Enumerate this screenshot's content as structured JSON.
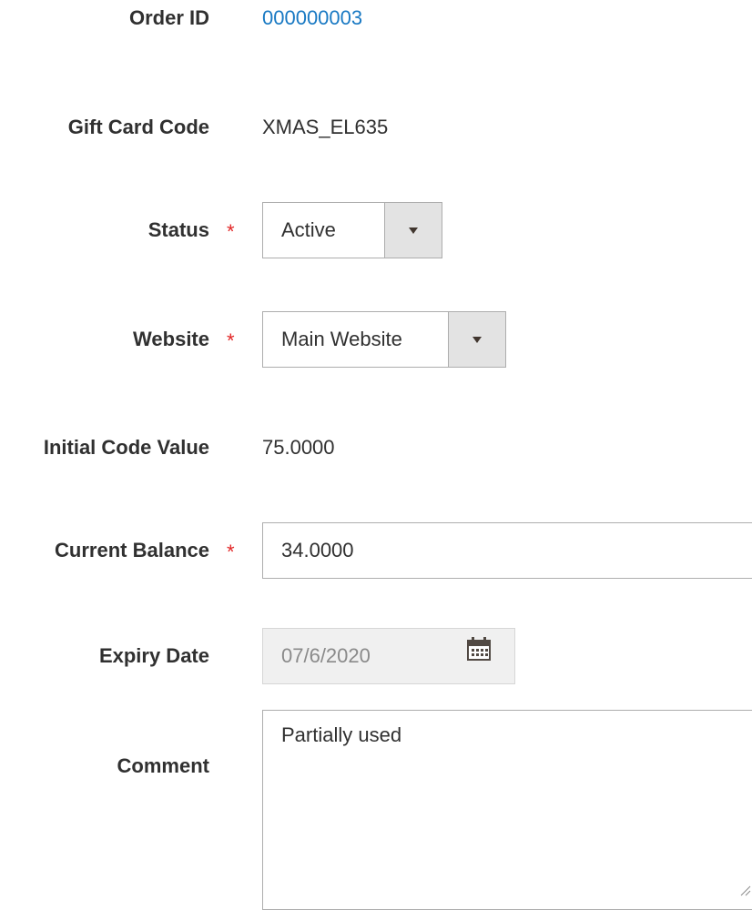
{
  "form": {
    "order_id": {
      "label": "Order ID",
      "value": "000000003"
    },
    "gift_card_code": {
      "label": "Gift Card Code",
      "value": "XMAS_EL635"
    },
    "status": {
      "label": "Status",
      "required_mark": "*",
      "selected": "Active"
    },
    "website": {
      "label": "Website",
      "required_mark": "*",
      "selected": "Main Website"
    },
    "initial_code_value": {
      "label": "Initial Code Value",
      "value": "75.0000"
    },
    "current_balance": {
      "label": "Current Balance",
      "required_mark": "*",
      "value": "34.0000"
    },
    "expiry_date": {
      "label": "Expiry Date",
      "value": "07/6/2020",
      "icon": "calendar-icon"
    },
    "comment": {
      "label": "Comment",
      "value": "Partially used"
    }
  },
  "colors": {
    "label": "#303030",
    "link": "#1979c3",
    "required": "#e22626",
    "border": "#adadad",
    "arrow_bg": "#e3e3e3",
    "disabled_bg": "#f0f0f0"
  }
}
